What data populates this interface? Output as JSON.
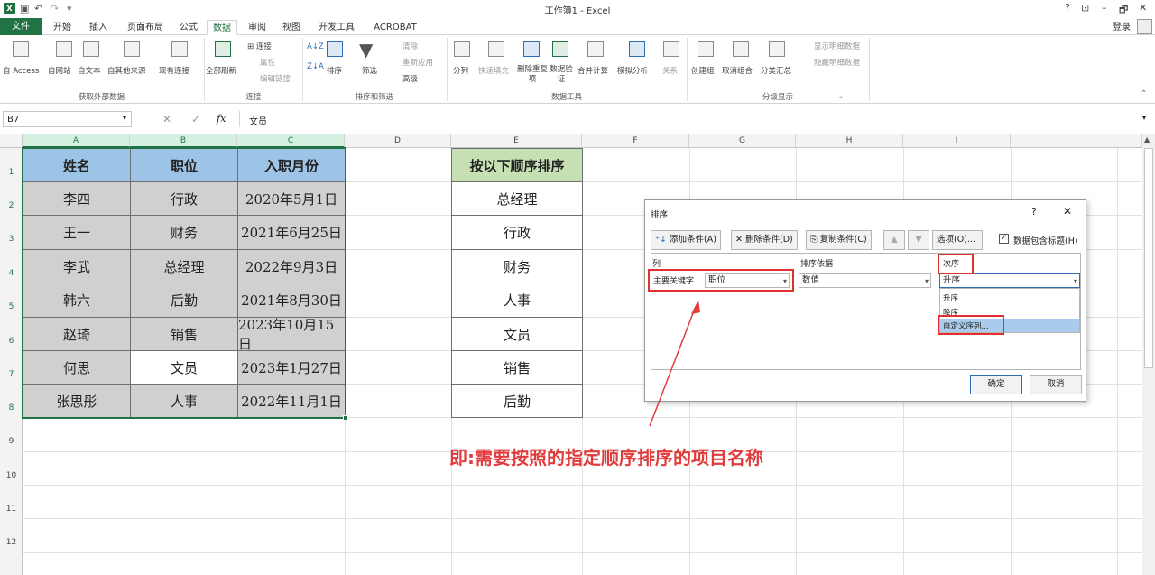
{
  "window": {
    "title": "工作簿1 - Excel",
    "controls": [
      "?",
      "⊡",
      "–",
      "🗗",
      "✕"
    ]
  },
  "ribbon": {
    "tabs": [
      "文件",
      "开始",
      "插入",
      "页面布局",
      "公式",
      "数据",
      "审阅",
      "视图",
      "开发工具",
      "ACROBAT"
    ],
    "active_tab": "数据",
    "signin": "登录",
    "groups": {
      "external": {
        "label": "获取外部数据",
        "buttons": [
          "自 Access",
          "自网站",
          "自文本",
          "自其他来源",
          "现有连接"
        ]
      },
      "connections": {
        "label": "连接",
        "refresh": "全部刷新",
        "items": [
          "连接",
          "属性",
          "编辑链接"
        ]
      },
      "sortfilter": {
        "label": "排序和筛选",
        "sort": "排序",
        "filter": "筛选",
        "items": [
          "清除",
          "重新应用",
          "高级"
        ]
      },
      "datatools": {
        "label": "数据工具",
        "buttons": [
          "分列",
          "快速填充",
          "删除重复项",
          "数据验证",
          "合并计算",
          "模拟分析",
          "关系"
        ]
      },
      "outline": {
        "label": "分级显示",
        "buttons": [
          "创建组",
          "取消组合",
          "分类汇总"
        ],
        "items": [
          "显示明细数据",
          "隐藏明细数据"
        ]
      }
    }
  },
  "formula_bar": {
    "name_box": "B7",
    "fx": "fx",
    "content": "文员"
  },
  "columns": [
    "A",
    "B",
    "C",
    "D",
    "E",
    "F",
    "G",
    "H",
    "I",
    "J"
  ],
  "rows": [
    "1",
    "2",
    "3",
    "4",
    "5",
    "6",
    "7",
    "8",
    "9",
    "10",
    "11",
    "12"
  ],
  "table": {
    "headers": [
      "姓名",
      "职位",
      "入职月份"
    ],
    "rows": [
      [
        "李四",
        "行政",
        "2020年5月1日"
      ],
      [
        "王一",
        "财务",
        "2021年6月25日"
      ],
      [
        "李武",
        "总经理",
        "2022年9月3日"
      ],
      [
        "韩六",
        "后勤",
        "2021年8月30日"
      ],
      [
        "赵琦",
        "销售",
        "2023年10月15日"
      ],
      [
        "何思",
        "文员",
        "2023年1月27日"
      ],
      [
        "张思彤",
        "人事",
        "2022年11月1日"
      ]
    ]
  },
  "order_list": {
    "header": "按以下顺序排序",
    "items": [
      "总经理",
      "行政",
      "财务",
      "人事",
      "文员",
      "销售",
      "后勤"
    ]
  },
  "dialog": {
    "title": "排序",
    "help": "?",
    "close": "✕",
    "add_level": "添加条件(A)",
    "delete_level": "删除条件(D)",
    "copy_level": "复制条件(C)",
    "options": "选项(O)...",
    "has_headers": "数据包含标题(H)",
    "col_header": "列",
    "sort_on_header": "排序依据",
    "order_header": "次序",
    "row_label": "主要关键字",
    "column_value": "职位",
    "sort_on_value": "数值",
    "order_value": "升序",
    "order_options": [
      "升序",
      "降序",
      "自定义序列..."
    ],
    "ok": "确定",
    "cancel": "取消"
  },
  "annotation": "即:需要按照的指定顺序排序的项目名称",
  "colors": {
    "excel_green": "#217346",
    "header_blue": "#9dc3e6",
    "list_header_green": "#c6e0b4",
    "annotation_red": "#e23b3b"
  }
}
